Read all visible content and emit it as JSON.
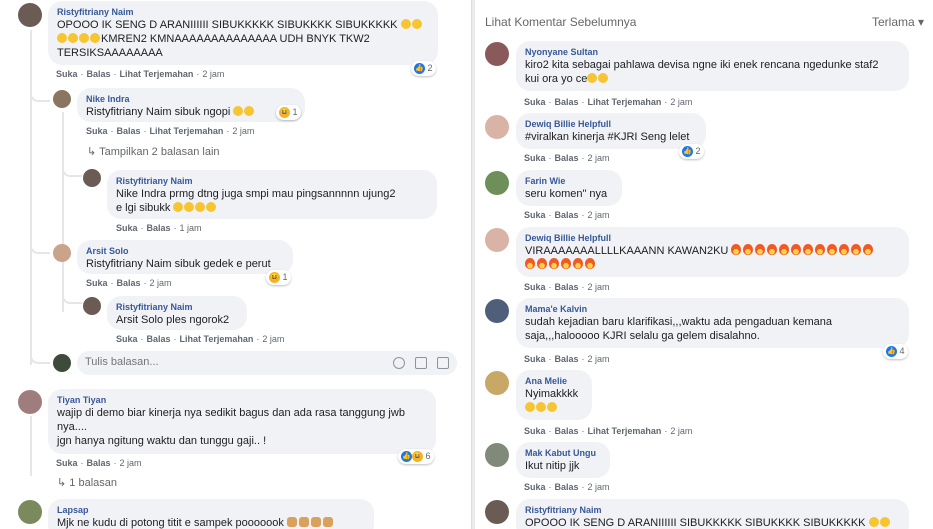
{
  "actions": {
    "like": "Suka",
    "reply": "Balas",
    "translate": "Lihat Terjemahan",
    "sep": "·"
  },
  "left": {
    "c1": {
      "author": "Ristyfitriany Naim",
      "line1": "OPOOO IK SENG D ARANIIIIII SIBUKKKKK SIBUKKKK SIBUKKKKK",
      "line2": "KMREN2 KMNAAAAAAAAAAAAAA UDH BNYK TKW2",
      "line3": "TERSIKSAAAAAAAA",
      "time": "2 jam",
      "reactions": "2"
    },
    "r1": {
      "author": "Nike Indra",
      "mention": "Ristyfitriany Naim",
      "text": "sibuk ngopi",
      "time": "2 jam",
      "reactions": "1"
    },
    "more1": "Tampilkan 2 balasan lain",
    "r2": {
      "author": "Ristyfitriany Naim",
      "mention": "Nike Indra",
      "line1": "prmg dtng juga smpi mau pingsannnnn ujung2",
      "line2": "e lgi sibukk",
      "time": "1 jam"
    },
    "r3": {
      "author": "Arsit Solo",
      "mention": "Ristyfitriany Naim",
      "text": "sibuk gedek e perut",
      "time": "2 jam",
      "reactions": "1"
    },
    "r4": {
      "author": "Ristyfitriany Naim",
      "mention": "Arsit Solo",
      "text": "ples ngorok2",
      "time": "2 jam"
    },
    "reply_placeholder": "Tulis balasan...",
    "c2": {
      "author": "Tiyan Tiyan",
      "line1": "wajip di demo biar kinerja nya sedikit bagus dan ada rasa tanggung jwb",
      "line2": "nya....",
      "line3": "jgn hanya ngitung waktu dan tunggu gaji.. !",
      "time": "2 jam",
      "reactions": "6"
    },
    "more2": "1 balasan",
    "c3": {
      "author": "Lapsap",
      "text": "Mjk ne kudu di potong titit e sampek pooooook"
    }
  },
  "right": {
    "prev": "Lihat Komentar Sebelumnya",
    "sort": "Terlama",
    "comments": [
      {
        "author": "Nyonyane Sultan",
        "line1": "kiro2 kita sebagai pahlawa devisa ngne iki enek rencana ngedunke staf2",
        "line2": "kui ora yo ce",
        "time": "2 jam"
      },
      {
        "author": "Dewiq Billie Helpfull",
        "line1": "#viralkan kinerja #KJRI Seng lelet",
        "time": "2 jam",
        "reactions": "2"
      },
      {
        "author": "Farin Wie",
        "line1": "seru komen\" nya",
        "time": "2 jam"
      },
      {
        "author": "Dewiq Billie Helpfull",
        "line1": "VIRAAAAAAALLLLKAAANN KAWAN2KU",
        "time": "2 jam"
      },
      {
        "author": "Mama'e Kalvin",
        "line1": "sudah kejadian baru klarifikasi,,,waktu ada pengaduan kemana",
        "line2": "saja,,,halooooo KJRI selalu ga gelem disalahno.",
        "time": "2 jam",
        "reactions": "4"
      },
      {
        "author": "Ana Melie",
        "line1": "Nyimakkkk",
        "time": "2 jam"
      },
      {
        "author": "Mak Kabut Ungu",
        "line1": "Ikut nitip jjk",
        "time": "2 jam"
      },
      {
        "author": "Ristyfitriany Naim",
        "line1": "OPOOO IK SENG D ARANIIIIII SIBUKKKKK SIBUKKKK SIBUKKKKK"
      }
    ]
  }
}
